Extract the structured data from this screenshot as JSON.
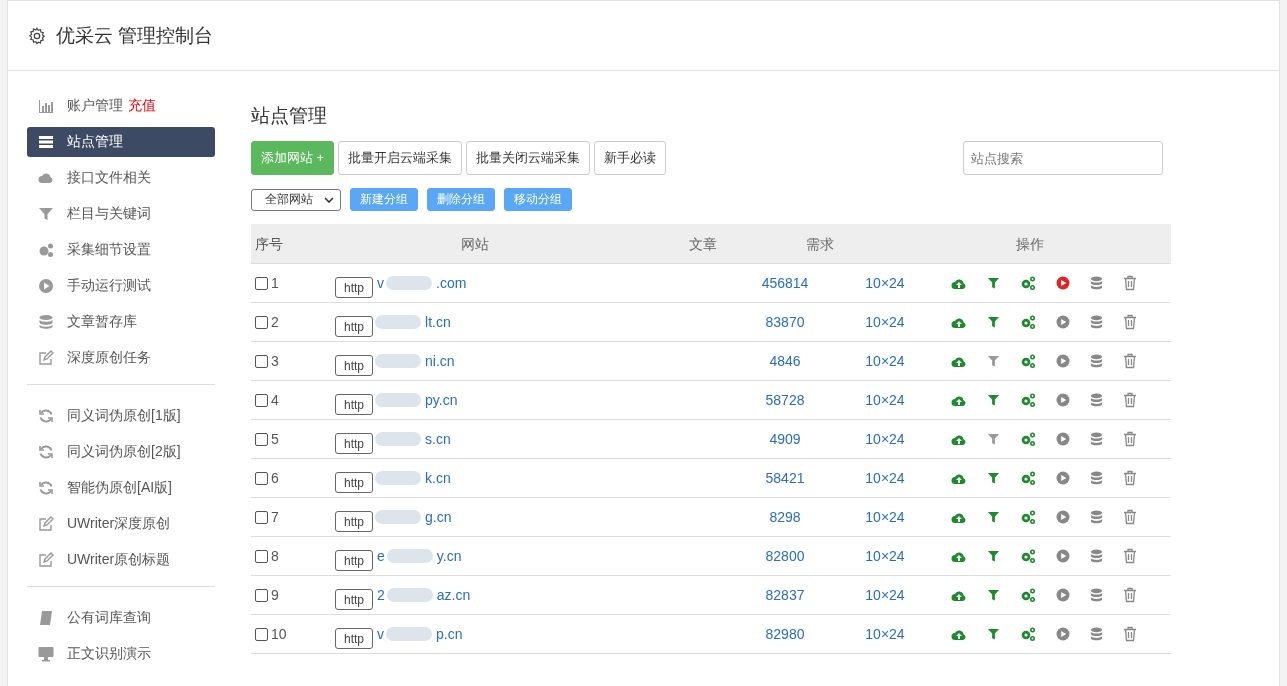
{
  "header": {
    "title": "优采云 管理控制台"
  },
  "sidebar": {
    "groups": [
      [
        {
          "label": "账户管理",
          "badge": "充值",
          "selected": false
        },
        {
          "label": "站点管理",
          "selected": true
        },
        {
          "label": "接口文件相关",
          "selected": false
        },
        {
          "label": "栏目与关键词",
          "selected": false
        },
        {
          "label": "采集细节设置",
          "selected": false
        },
        {
          "label": "手动运行测试",
          "selected": false
        },
        {
          "label": "文章暂存库",
          "selected": false
        },
        {
          "label": "深度原创任务",
          "selected": false
        }
      ],
      [
        {
          "label": "同义词伪原创[1版]",
          "selected": false
        },
        {
          "label": "同义词伪原创[2版]",
          "selected": false
        },
        {
          "label": "智能伪原创[AI版]",
          "selected": false
        },
        {
          "label": "UWriter深度原创",
          "selected": false
        },
        {
          "label": "UWriter原创标题",
          "selected": false
        }
      ],
      [
        {
          "label": "公有词库查询",
          "selected": false
        },
        {
          "label": "正文识别演示",
          "selected": false
        }
      ]
    ]
  },
  "main": {
    "title": "站点管理",
    "buttons": [
      {
        "label": "添加网站 +",
        "kind": "primary"
      },
      {
        "label": "批量开启云端采集",
        "kind": "default"
      },
      {
        "label": "批量关闭云端采集",
        "kind": "default"
      },
      {
        "label": "新手必读",
        "kind": "default"
      }
    ],
    "search": {
      "placeholder": "站点搜索"
    },
    "group_select": {
      "value": "全部网站"
    },
    "group_buttons": [
      "新建分组",
      "删除分组",
      "移动分组"
    ],
    "table": {
      "columns": [
        "序号",
        "网站",
        "文章",
        "需求",
        "操作"
      ],
      "rows": [
        {
          "checked": false,
          "number": "1",
          "scheme": "http",
          "domain_start": "v",
          "domain_end": ".com",
          "articles": "456814",
          "demand": "10×24",
          "filter_on": true,
          "running": true
        },
        {
          "checked": false,
          "number": "2",
          "scheme": "http",
          "domain_start": "",
          "domain_end": "lt.cn",
          "articles": "83870",
          "demand": "10×24",
          "filter_on": true,
          "running": false
        },
        {
          "checked": false,
          "number": "3",
          "scheme": "http",
          "domain_start": "",
          "domain_end": "ni.cn",
          "articles": "4846",
          "demand": "10×24",
          "filter_on": false,
          "running": false
        },
        {
          "checked": false,
          "number": "4",
          "scheme": "http",
          "domain_start": "",
          "domain_end": "py.cn",
          "articles": "58728",
          "demand": "10×24",
          "filter_on": true,
          "running": false
        },
        {
          "checked": false,
          "number": "5",
          "scheme": "http",
          "domain_start": "",
          "domain_end": "s.cn",
          "articles": "4909",
          "demand": "10×24",
          "filter_on": false,
          "running": false
        },
        {
          "checked": false,
          "number": "6",
          "scheme": "http",
          "domain_start": "",
          "domain_end": "k.cn",
          "articles": "58421",
          "demand": "10×24",
          "filter_on": true,
          "running": false
        },
        {
          "checked": false,
          "number": "7",
          "scheme": "http",
          "domain_start": "",
          "domain_end": "g.cn",
          "articles": "8298",
          "demand": "10×24",
          "filter_on": true,
          "running": false
        },
        {
          "checked": false,
          "number": "8",
          "scheme": "http",
          "domain_start": "e",
          "domain_end": "y.cn",
          "articles": "82800",
          "demand": "10×24",
          "filter_on": true,
          "running": false
        },
        {
          "checked": false,
          "number": "9",
          "scheme": "http",
          "domain_start": "2",
          "domain_end": "az.cn",
          "articles": "82837",
          "demand": "10×24",
          "filter_on": true,
          "running": false
        },
        {
          "checked": false,
          "number": "10",
          "scheme": "http",
          "domain_start": "v",
          "domain_end": "p.cn",
          "articles": "82980",
          "demand": "10×24",
          "filter_on": true,
          "running": false
        }
      ]
    }
  }
}
